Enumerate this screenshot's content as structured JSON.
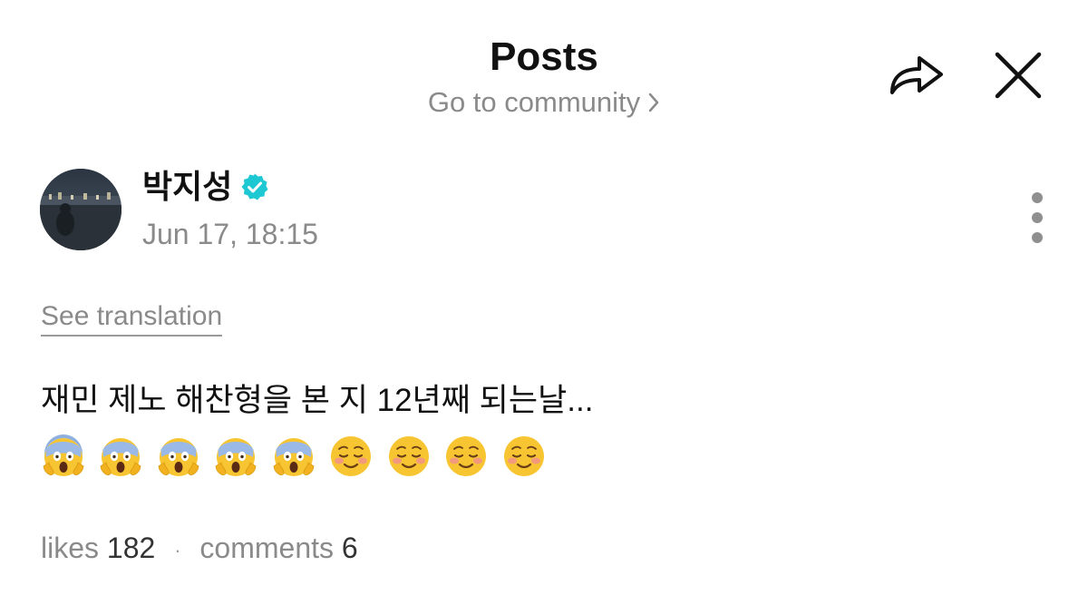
{
  "header": {
    "title": "Posts",
    "community_link_label": "Go to community",
    "share_icon": "share-arrow-icon",
    "close_icon": "close-icon"
  },
  "post": {
    "author": {
      "name": "박지성",
      "verified": true,
      "verified_color": "#1ec8d2",
      "avatar_description_icon": "avatar-image"
    },
    "timestamp": "Jun 17, 18:15",
    "see_translation_label": "See translation",
    "text": "재민 제노 해찬형을 본 지 12년째 되는날...",
    "emojis": [
      "face-screaming-in-fear",
      "face-screaming-in-fear",
      "face-screaming-in-fear",
      "face-screaming-in-fear",
      "face-screaming-in-fear",
      "smiling-face",
      "smiling-face",
      "smiling-face",
      "smiling-face"
    ],
    "stats": {
      "likes_label": "likes",
      "likes_count": "182",
      "separator": "·",
      "comments_label": "comments",
      "comments_count": "6"
    }
  },
  "colors": {
    "muted_text": "#8a8a8a",
    "primary_text": "#111111",
    "verified_badge": "#1ec8d2"
  }
}
